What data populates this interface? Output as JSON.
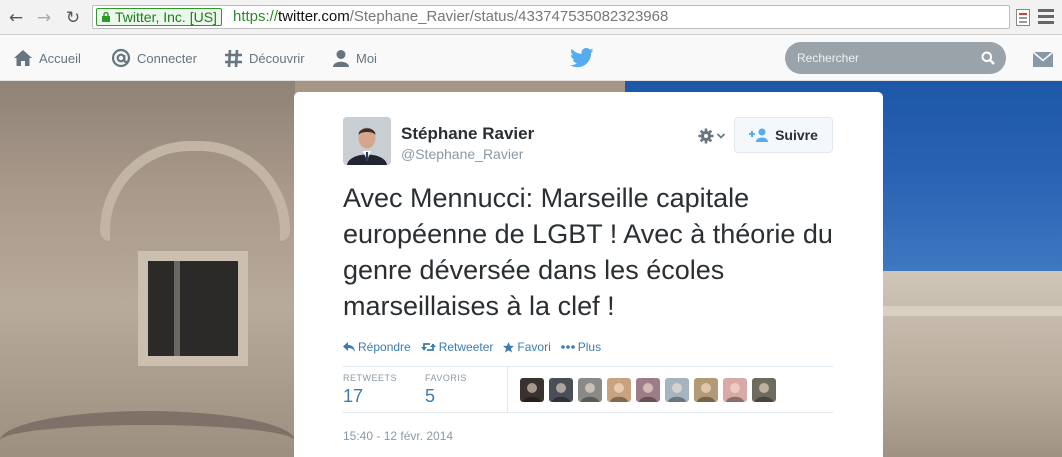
{
  "browser": {
    "ssl_label": "Twitter, Inc. [US]",
    "url_protocol": "https://",
    "url_host": "twitter.com",
    "url_path": "/Stephane_Ravier/status/433747535082323968"
  },
  "topbar": {
    "nav": [
      {
        "label": "Accueil",
        "icon": "home-icon"
      },
      {
        "label": "Connecter",
        "icon": "at-icon"
      },
      {
        "label": "Découvrir",
        "icon": "hashtag-icon"
      },
      {
        "label": "Moi",
        "icon": "person-icon"
      }
    ],
    "search_placeholder": "Rechercher",
    "brand_color": "#55acee"
  },
  "tweet": {
    "author_name": "Stéphane Ravier",
    "author_handle": "@Stephane_Ravier",
    "follow_label": "Suivre",
    "text": "Avec Mennucci: Marseille capitale européenne de LGBT ! Avec  à théorie du genre déversée dans les écoles marseillaises à la clef !",
    "actions": [
      {
        "label": "Répondre",
        "icon": "reply-icon"
      },
      {
        "label": "Retweeter",
        "icon": "retweet-icon"
      },
      {
        "label": "Favori",
        "icon": "star-icon"
      },
      {
        "label": "Plus",
        "icon": "more-icon"
      }
    ],
    "stats": {
      "retweets_label": "RETWEETS",
      "retweets_value": "17",
      "favorites_label": "FAVORIS",
      "favorites_value": "5"
    },
    "favoriter_avatar_colors": [
      "#3a3230",
      "#4a4e57",
      "#8a8a88",
      "#c9a27f",
      "#9d7d86",
      "#a6b4c0",
      "#b39a76",
      "#d9a9a6",
      "#6f6a5e"
    ],
    "timestamp": "15:40 - 12 févr. 2014"
  }
}
